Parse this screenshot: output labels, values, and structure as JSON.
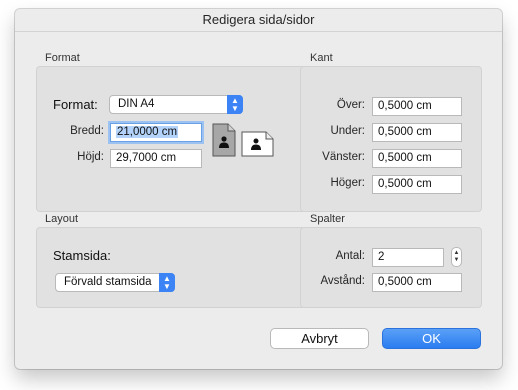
{
  "dialog": {
    "title": "Redigera sida/sidor"
  },
  "format": {
    "section_label": "Format",
    "format_label": "Format:",
    "format_value": "DIN A4",
    "width_label": "Bredd:",
    "width_value": "21,0000 cm",
    "height_label": "Höjd:",
    "height_value": "29,7000 cm",
    "orientation": {
      "portrait_icon": "portrait-person-icon",
      "landscape_icon": "landscape-person-icon",
      "selected": "portrait"
    }
  },
  "margins": {
    "section_label": "Kant",
    "top_label": "Över:",
    "top_value": "0,5000 cm",
    "bottom_label": "Under:",
    "bottom_value": "0,5000 cm",
    "left_label": "Vänster:",
    "left_value": "0,5000 cm",
    "right_label": "Höger:",
    "right_value": "0,5000 cm"
  },
  "layout": {
    "section_label": "Layout",
    "master_label": "Stamsida:",
    "master_value": "Förvald stamsida"
  },
  "columns": {
    "section_label": "Spalter",
    "count_label": "Antal:",
    "count_value": "2",
    "spacing_label": "Avstånd:",
    "spacing_value": "0,5000 cm"
  },
  "buttons": {
    "cancel": "Avbryt",
    "ok": "OK"
  },
  "colors": {
    "accent": "#3c84f5",
    "selection": "#b3d3fb"
  }
}
